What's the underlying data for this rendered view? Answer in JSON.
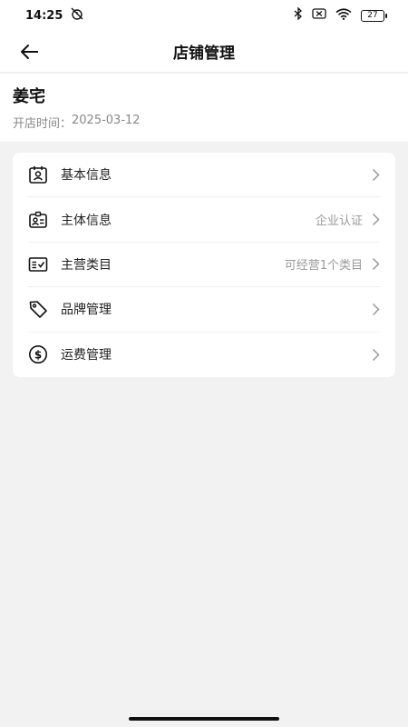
{
  "status_bar": {
    "time": "14:25",
    "battery": "27"
  },
  "nav": {
    "title": "店铺管理"
  },
  "store": {
    "name": "姜宅",
    "open_label": "开店时间：",
    "open_date": "2025-03-12"
  },
  "menu": [
    {
      "label": "基本信息",
      "value": "",
      "icon": "id-badge-icon"
    },
    {
      "label": "主体信息",
      "value": "企业认证",
      "icon": "id-card-icon"
    },
    {
      "label": "主营类目",
      "value": "可经营1个类目",
      "icon": "category-list-icon"
    },
    {
      "label": "品牌管理",
      "value": "",
      "icon": "tag-icon"
    },
    {
      "label": "运费管理",
      "value": "",
      "icon": "dollar-circle-icon"
    }
  ]
}
